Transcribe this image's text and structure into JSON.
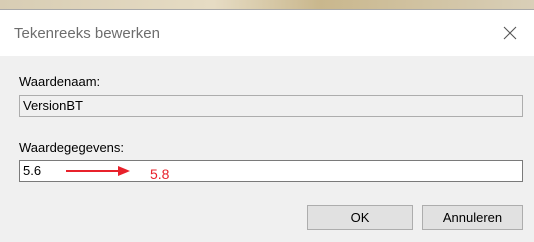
{
  "dialog": {
    "title": "Tekenreeks bewerken",
    "close_icon": "close-icon"
  },
  "value_name": {
    "label": "Waardenaam:",
    "value": "VersionBT"
  },
  "value_data": {
    "label": "Waardegegevens:",
    "value": "5.6"
  },
  "annotation": {
    "text": "5.8",
    "color": "#e8212b",
    "icon": "arrow-right-icon"
  },
  "buttons": {
    "ok": "OK",
    "cancel": "Annuleren"
  }
}
